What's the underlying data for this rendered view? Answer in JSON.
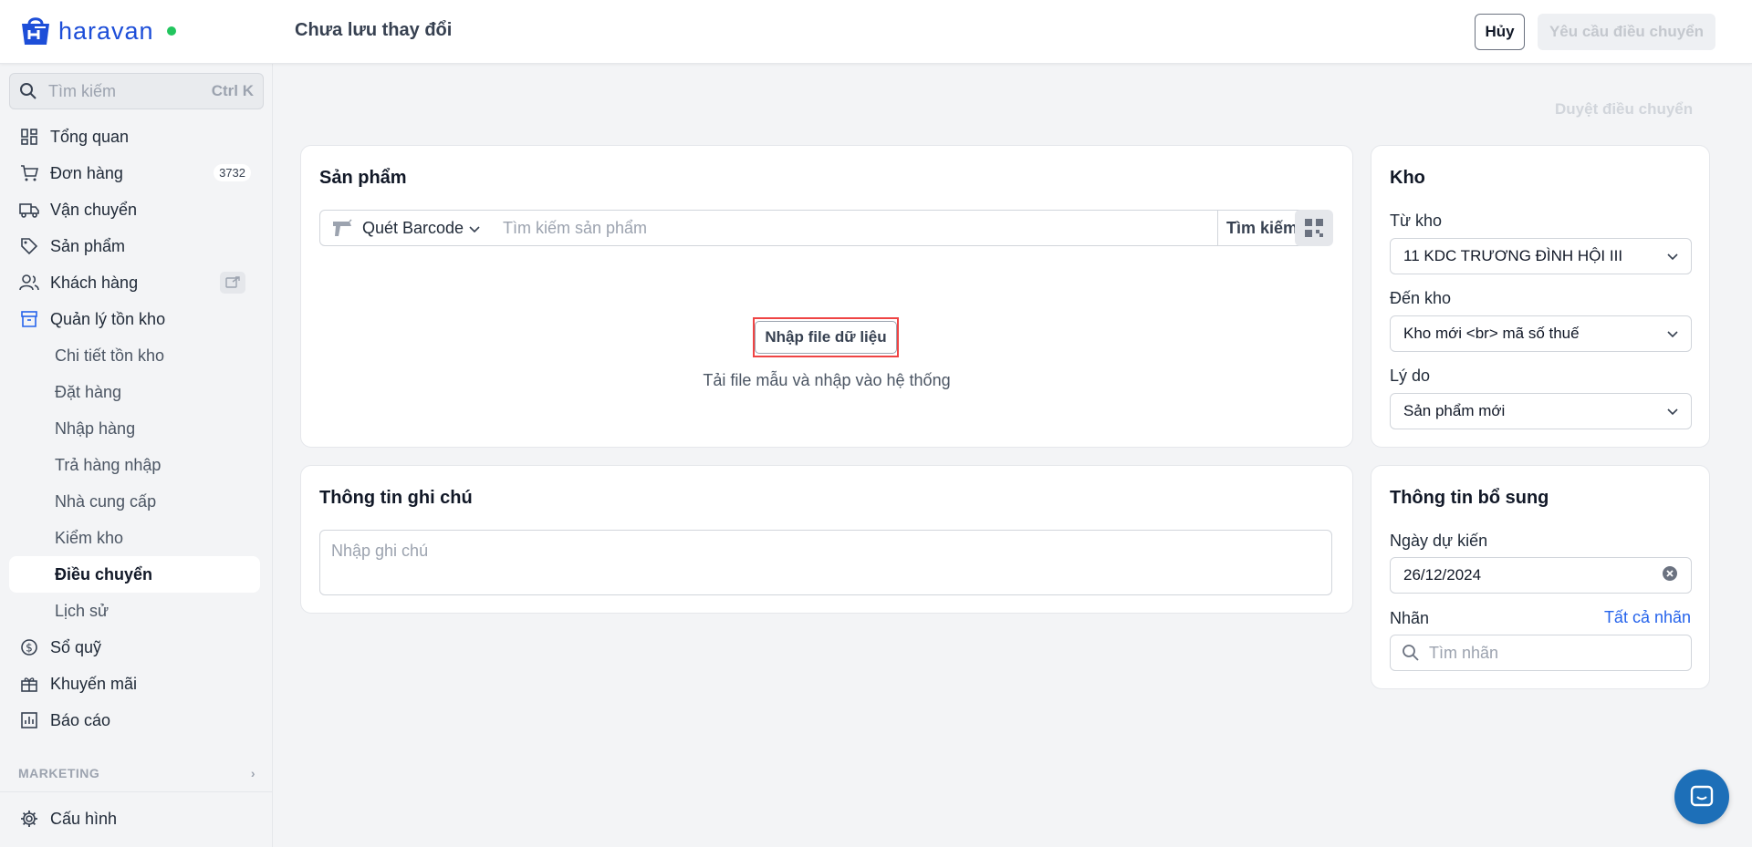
{
  "header": {
    "logo_text": "haravan",
    "title": "Chưa lưu thay đổi",
    "cancel_label": "Hủy",
    "request_label": "Yêu cầu điều chuyển"
  },
  "sidebar": {
    "search_placeholder": "Tìm kiếm",
    "search_shortcut": "Ctrl K",
    "items": [
      {
        "label": "Tổng quan",
        "icon": "dashboard-icon"
      },
      {
        "label": "Đơn hàng",
        "icon": "cart-icon",
        "badge": "3732"
      },
      {
        "label": "Vận chuyển",
        "icon": "truck-icon"
      },
      {
        "label": "Sản phẩm",
        "icon": "tag-icon"
      },
      {
        "label": "Khách hàng",
        "icon": "users-icon"
      },
      {
        "label": "Quản lý tồn kho",
        "icon": "archive-icon"
      }
    ],
    "sub_items": [
      {
        "label": "Chi tiết tồn kho"
      },
      {
        "label": "Đặt hàng"
      },
      {
        "label": "Nhập hàng"
      },
      {
        "label": "Trả hàng nhập"
      },
      {
        "label": "Nhà cung cấp"
      },
      {
        "label": "Kiểm kho"
      },
      {
        "label": "Điều chuyển",
        "selected": true
      },
      {
        "label": "Lịch sử"
      }
    ],
    "items_after": [
      {
        "label": "Sổ quỹ",
        "icon": "dollar-icon"
      },
      {
        "label": "Khuyến mãi",
        "icon": "gift-icon"
      },
      {
        "label": "Báo cáo",
        "icon": "report-icon"
      }
    ],
    "marketing_label": "MARKETING",
    "config_label": "Cấu hình"
  },
  "main": {
    "approve_label": "Duyệt điều chuyển",
    "product": {
      "title": "Sản phẩm",
      "scan_label": "Quét Barcode",
      "search_placeholder": "Tìm kiếm sản phẩm",
      "search_button": "Tìm kiếm",
      "import_button": "Nhập file dữ liệu",
      "import_desc": "Tải file mẫu và nhập vào hệ thống"
    },
    "note": {
      "title": "Thông tin ghi chú",
      "placeholder": "Nhập ghi chú"
    },
    "warehouse": {
      "title": "Kho",
      "from_label": "Từ kho",
      "from_value": "11 KDC TRƯƠNG ĐÌNH HỘI III",
      "to_label": "Đến kho",
      "to_value": "Kho mới <br> mã số thuế",
      "reason_label": "Lý do",
      "reason_value": "Sản phẩm mới"
    },
    "extra": {
      "title": "Thông tin bổ sung",
      "date_label": "Ngày dự kiến",
      "date_value": "26/12/2024",
      "tag_label": "Nhãn",
      "all_tags_link": "Tất cả nhãn",
      "tag_placeholder": "Tìm nhãn"
    }
  },
  "colors": {
    "brand": "#1d4ed8",
    "link": "#2563eb",
    "highlight": "#ef4444",
    "chat": "#1d6fb8"
  }
}
